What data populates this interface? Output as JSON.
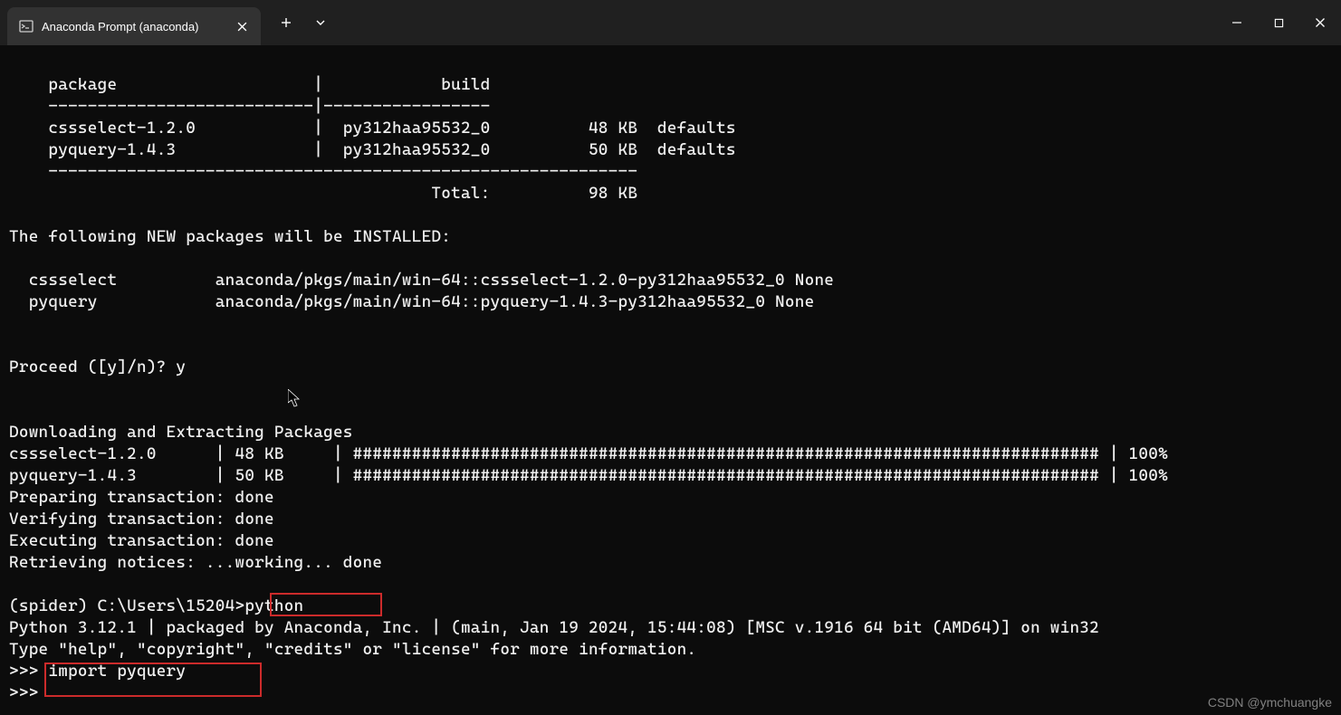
{
  "tab": {
    "title": "Anaconda Prompt (anaconda)"
  },
  "terminal": {
    "lines": [
      "",
      "    package                    |            build",
      "    ---------------------------|-----------------",
      "    cssselect-1.2.0            |  py312haa95532_0          48 KB  defaults",
      "    pyquery-1.4.3              |  py312haa95532_0          50 KB  defaults",
      "    ------------------------------------------------------------",
      "                                           Total:          98 KB",
      "",
      "The following NEW packages will be INSTALLED:",
      "",
      "  cssselect          anaconda/pkgs/main/win-64::cssselect-1.2.0-py312haa95532_0 None",
      "  pyquery            anaconda/pkgs/main/win-64::pyquery-1.4.3-py312haa95532_0 None",
      "",
      "",
      "Proceed ([y]/n)? y",
      "",
      "",
      "Downloading and Extracting Packages",
      "cssselect-1.2.0      | 48 KB     | ############################################################################ | 100%",
      "pyquery-1.4.3        | 50 KB     | ############################################################################ | 100%",
      "Preparing transaction: done",
      "Verifying transaction: done",
      "Executing transaction: done",
      "Retrieving notices: ...working... done",
      "",
      "(spider) C:\\Users\\15204>python",
      "Python 3.12.1 | packaged by Anaconda, Inc. | (main, Jan 19 2024, 15:44:08) [MSC v.1916 64 bit (AMD64)] on win32",
      "Type \"help\", \"copyright\", \"credits\" or \"license\" for more information.",
      ">>> import pyquery",
      ">>> "
    ]
  },
  "watermark": "CSDN @ymchuangke"
}
